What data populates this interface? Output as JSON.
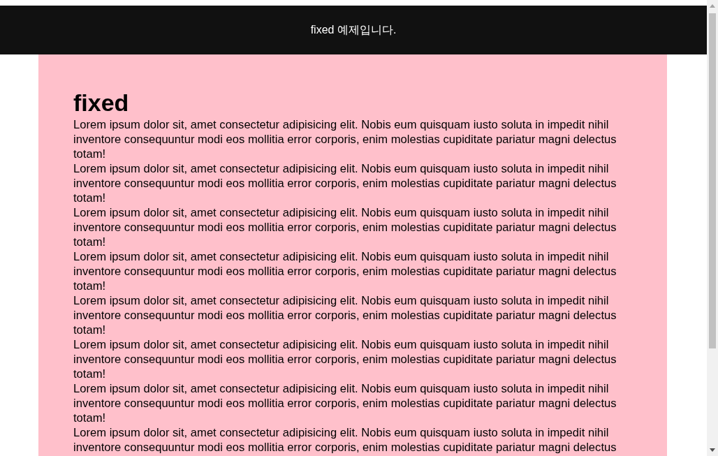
{
  "header": {
    "text": "fixed 예제입니다."
  },
  "content": {
    "heading": "fixed",
    "paragraphs": [
      "Lorem ipsum dolor sit, amet consectetur adipisicing elit. Nobis eum quisquam iusto soluta in impedit nihil inventore consequuntur modi eos mollitia error corporis, enim molestias cupiditate pariatur magni delectus totam!",
      "Lorem ipsum dolor sit, amet consectetur adipisicing elit. Nobis eum quisquam iusto soluta in impedit nihil inventore consequuntur modi eos mollitia error corporis, enim molestias cupiditate pariatur magni delectus totam!",
      "Lorem ipsum dolor sit, amet consectetur adipisicing elit. Nobis eum quisquam iusto soluta in impedit nihil inventore consequuntur modi eos mollitia error corporis, enim molestias cupiditate pariatur magni delectus totam!",
      "Lorem ipsum dolor sit, amet consectetur adipisicing elit. Nobis eum quisquam iusto soluta in impedit nihil inventore consequuntur modi eos mollitia error corporis, enim molestias cupiditate pariatur magni delectus totam!",
      "Lorem ipsum dolor sit, amet consectetur adipisicing elit. Nobis eum quisquam iusto soluta in impedit nihil inventore consequuntur modi eos mollitia error corporis, enim molestias cupiditate pariatur magni delectus totam!",
      "Lorem ipsum dolor sit, amet consectetur adipisicing elit. Nobis eum quisquam iusto soluta in impedit nihil inventore consequuntur modi eos mollitia error corporis, enim molestias cupiditate pariatur magni delectus totam!",
      "Lorem ipsum dolor sit, amet consectetur adipisicing elit. Nobis eum quisquam iusto soluta in impedit nihil inventore consequuntur modi eos mollitia error corporis, enim molestias cupiditate pariatur magni delectus totam!",
      "Lorem ipsum dolor sit, amet consectetur adipisicing elit. Nobis eum quisquam iusto soluta in impedit nihil inventore consequuntur modi eos mollitia error corporis, enim molestias cupiditate pariatur magni delectus"
    ]
  }
}
